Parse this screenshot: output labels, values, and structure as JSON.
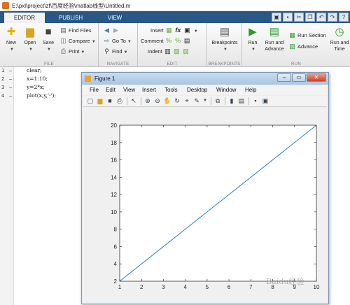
{
  "window": {
    "title": "E:\\pxl\\project\\zf\\百度经验\\matlab线型\\Untitled.m"
  },
  "tabs": [
    "EDITOR",
    "PUBLISH",
    "VIEW"
  ],
  "ribbon": {
    "file": {
      "label": "FILE",
      "new": "New",
      "open": "Open",
      "save": "Save",
      "find_files": "Find Files",
      "compare": "Compare",
      "print": "Print"
    },
    "navigate": {
      "label": "NAVIGATE",
      "goto": "Go To",
      "find": "Find"
    },
    "edit": {
      "label": "EDIT",
      "insert": "Insert",
      "fx": "fx",
      "comment": "Comment",
      "indent": "Indent"
    },
    "breakpoints": {
      "label": "BREAKPOINTS",
      "breakpoints": "Breakpoints"
    },
    "run": {
      "label": "RUN",
      "run": "Run",
      "run_and": "Run and",
      "advance": "Advance",
      "run_section": "Run Section",
      "advance2": "Advance",
      "run_and_time": "Run and",
      "time": "Time"
    }
  },
  "editor": {
    "lines": [
      {
        "num": "1",
        "mark": "–",
        "code": "clear;"
      },
      {
        "num": "2",
        "mark": "–",
        "code": "x=1:10;"
      },
      {
        "num": "3",
        "mark": "–",
        "code": "y=2*x;"
      },
      {
        "num": "4",
        "mark": "–",
        "code": "plot(x,y,'-');"
      }
    ]
  },
  "figure": {
    "title": "Figure 1",
    "menu": [
      "File",
      "Edit",
      "View",
      "Insert",
      "Tools",
      "Desktop",
      "Window",
      "Help"
    ]
  },
  "chart_data": {
    "type": "line",
    "x": [
      1,
      2,
      3,
      4,
      5,
      6,
      7,
      8,
      9,
      10
    ],
    "series": [
      {
        "values": [
          2,
          4,
          6,
          8,
          10,
          12,
          14,
          16,
          18,
          20
        ],
        "color": "#2e7bbd"
      }
    ],
    "xlim": [
      1,
      10
    ],
    "ylim": [
      2,
      20
    ],
    "xticks": [
      1,
      2,
      3,
      4,
      5,
      6,
      7,
      8,
      9,
      10
    ],
    "yticks": [
      2,
      4,
      6,
      8,
      10,
      12,
      14,
      16,
      18,
      20
    ],
    "grid": false
  },
  "watermark": "Baidu经验"
}
